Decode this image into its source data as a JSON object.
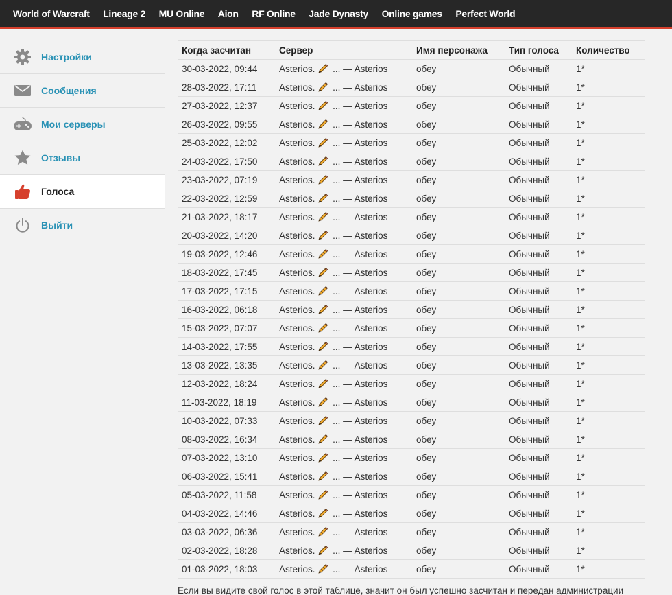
{
  "topnav": {
    "items": [
      "World of Warcraft",
      "Lineage 2",
      "MU Online",
      "Aion",
      "RF Online",
      "Jade Dynasty",
      "Online games",
      "Perfect World"
    ]
  },
  "sidebar": {
    "items": [
      {
        "label": "Настройки",
        "icon": "gear-icon"
      },
      {
        "label": "Сообщения",
        "icon": "envelope-icon"
      },
      {
        "label": "Мои серверы",
        "icon": "gamepad-icon"
      },
      {
        "label": "Отзывы",
        "icon": "star-icon"
      },
      {
        "label": "Голоса",
        "icon": "thumbs-up-icon",
        "active": true
      },
      {
        "label": "Выйти",
        "icon": "power-icon"
      }
    ]
  },
  "votes_table": {
    "headers": [
      "Когда засчитан",
      "Сервер",
      "Имя персонажа",
      "Тип голоса",
      "Количество"
    ],
    "server_prefix": "Asterios.",
    "server_suffix": "... — Asterios",
    "rows": [
      {
        "date": "30-03-2022, 09:44",
        "character": "обеу",
        "type": "Обычный",
        "count": "1*"
      },
      {
        "date": "28-03-2022, 17:11",
        "character": "обеу",
        "type": "Обычный",
        "count": "1*"
      },
      {
        "date": "27-03-2022, 12:37",
        "character": "обеу",
        "type": "Обычный",
        "count": "1*"
      },
      {
        "date": "26-03-2022, 09:55",
        "character": "обеу",
        "type": "Обычный",
        "count": "1*"
      },
      {
        "date": "25-03-2022, 12:02",
        "character": "обеу",
        "type": "Обычный",
        "count": "1*"
      },
      {
        "date": "24-03-2022, 17:50",
        "character": "обеу",
        "type": "Обычный",
        "count": "1*"
      },
      {
        "date": "23-03-2022, 07:19",
        "character": "обеу",
        "type": "Обычный",
        "count": "1*"
      },
      {
        "date": "22-03-2022, 12:59",
        "character": "обеу",
        "type": "Обычный",
        "count": "1*"
      },
      {
        "date": "21-03-2022, 18:17",
        "character": "обеу",
        "type": "Обычный",
        "count": "1*"
      },
      {
        "date": "20-03-2022, 14:20",
        "character": "обеу",
        "type": "Обычный",
        "count": "1*"
      },
      {
        "date": "19-03-2022, 12:46",
        "character": "обеу",
        "type": "Обычный",
        "count": "1*"
      },
      {
        "date": "18-03-2022, 17:45",
        "character": "обеу",
        "type": "Обычный",
        "count": "1*"
      },
      {
        "date": "17-03-2022, 17:15",
        "character": "обеу",
        "type": "Обычный",
        "count": "1*"
      },
      {
        "date": "16-03-2022, 06:18",
        "character": "обеу",
        "type": "Обычный",
        "count": "1*"
      },
      {
        "date": "15-03-2022, 07:07",
        "character": "обеу",
        "type": "Обычный",
        "count": "1*"
      },
      {
        "date": "14-03-2022, 17:55",
        "character": "обеу",
        "type": "Обычный",
        "count": "1*"
      },
      {
        "date": "13-03-2022, 13:35",
        "character": "обеу",
        "type": "Обычный",
        "count": "1*"
      },
      {
        "date": "12-03-2022, 18:24",
        "character": "обеу",
        "type": "Обычный",
        "count": "1*"
      },
      {
        "date": "11-03-2022, 18:19",
        "character": "обеу",
        "type": "Обычный",
        "count": "1*"
      },
      {
        "date": "10-03-2022, 07:33",
        "character": "обеу",
        "type": "Обычный",
        "count": "1*"
      },
      {
        "date": "08-03-2022, 16:34",
        "character": "обеу",
        "type": "Обычный",
        "count": "1*"
      },
      {
        "date": "07-03-2022, 13:10",
        "character": "обеу",
        "type": "Обычный",
        "count": "1*"
      },
      {
        "date": "06-03-2022, 15:41",
        "character": "обеу",
        "type": "Обычный",
        "count": "1*"
      },
      {
        "date": "05-03-2022, 11:58",
        "character": "обеу",
        "type": "Обычный",
        "count": "1*"
      },
      {
        "date": "04-03-2022, 14:46",
        "character": "обеу",
        "type": "Обычный",
        "count": "1*"
      },
      {
        "date": "03-03-2022, 06:36",
        "character": "обеу",
        "type": "Обычный",
        "count": "1*"
      },
      {
        "date": "02-03-2022, 18:28",
        "character": "обеу",
        "type": "Обычный",
        "count": "1*"
      },
      {
        "date": "01-03-2022, 18:03",
        "character": "обеу",
        "type": "Обычный",
        "count": "1*"
      }
    ]
  },
  "footer_note": "Если вы видите свой голос в этой таблице, значит он был успешно засчитан и передан администрации",
  "colors": {
    "accent": "#d6402d",
    "link": "#2a92b5",
    "nav_bg": "#272727"
  }
}
